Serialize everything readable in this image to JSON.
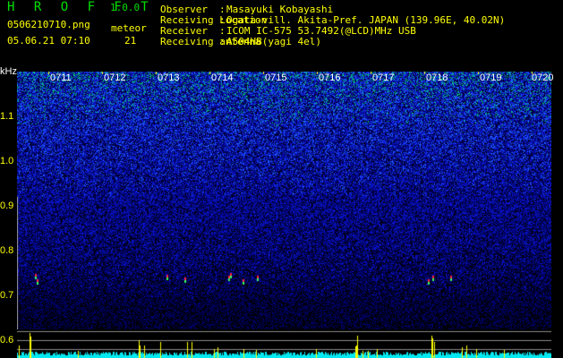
{
  "header": {
    "app_title": "H R O F F T",
    "version": "1.0.0",
    "filename": "0506210710.png",
    "datetime": "05.06.21 07:10",
    "meteor_label": "meteor",
    "meteor_count": "21",
    "info": [
      {
        "label": "Observer",
        "value": "Masayuki Kobayashi"
      },
      {
        "label": "Receiving Location",
        "value": "Ogata-vill. Akita-Pref. JAPAN (139.96E, 40.02N)"
      },
      {
        "label": "Receiver",
        "value": "ICOM IC-575 53.7492(@LCD)MHz USB"
      },
      {
        "label": "Receiving antenna",
        "value": "A504HB(yagi 4el)"
      }
    ]
  },
  "spectrogram": {
    "unit": "kHz",
    "freq_labels": [
      "1.1",
      "1.0",
      "0.9",
      "0.8",
      "0.7",
      "0.6"
    ],
    "time_labels": [
      "0711",
      "0712",
      "0713",
      "0714",
      "0715",
      "0716",
      "0717",
      "0718",
      "0719",
      "0720"
    ]
  }
}
